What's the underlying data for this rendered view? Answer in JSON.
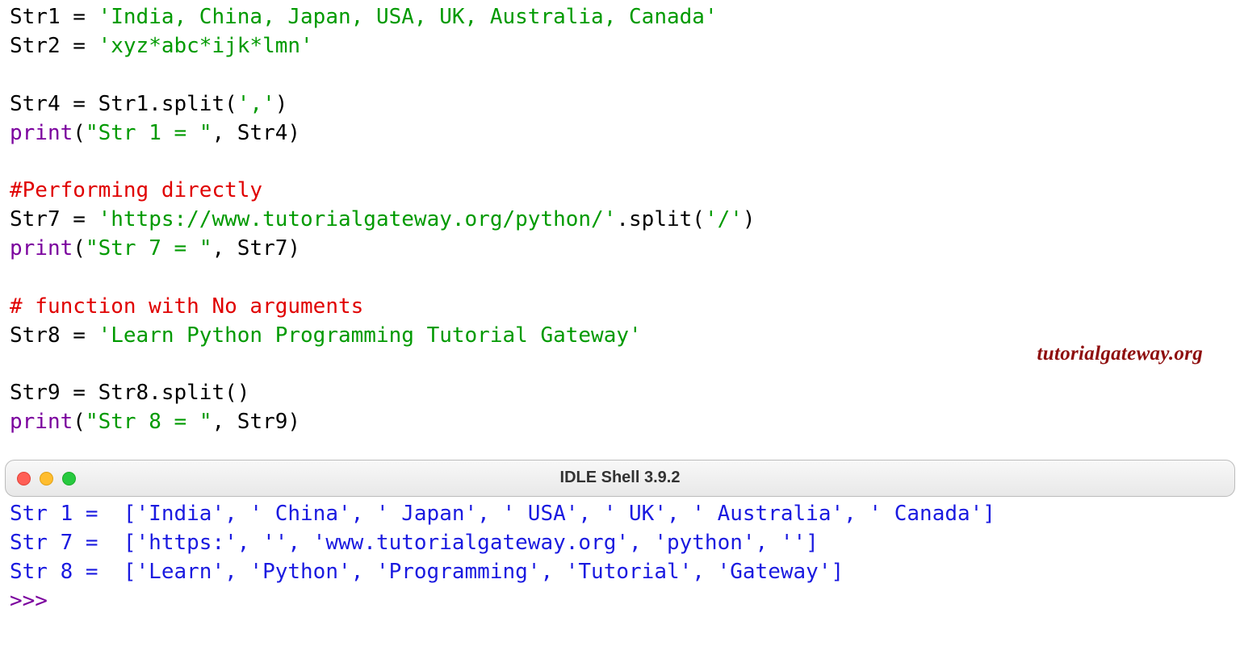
{
  "code": {
    "l1a": "Str1 = ",
    "l1b": "'India, China, Japan, USA, UK, Australia, Canada'",
    "l2a": "Str2 = ",
    "l2b": "'xyz*abc*ijk*lmn'",
    "l4a": "Str4 = Str1.split(",
    "l4b": "','",
    "l4c": ")",
    "l5a": "print",
    "l5b": "(",
    "l5c": "\"Str 1 = \"",
    "l5d": ", Str4)",
    "l7": "#Performing directly",
    "l8a": "Str7 = ",
    "l8b": "'https://www.tutorialgateway.org/python/'",
    "l8c": ".split(",
    "l8d": "'/'",
    "l8e": ")",
    "l9a": "print",
    "l9b": "(",
    "l9c": "\"Str 7 = \"",
    "l9d": ", Str7)",
    "l11": "# function with No arguments",
    "l12a": "Str8 = ",
    "l12b": "'Learn Python Programming Tutorial Gateway'",
    "l14": "Str9 = Str8.split()",
    "l15a": "print",
    "l15b": "(",
    "l15c": "\"Str 8 = \"",
    "l15d": ", Str9)"
  },
  "watermark": "tutorialgateway.org",
  "shell": {
    "title": "IDLE Shell 3.9.2",
    "out1": "Str 1 =  ['India', ' China', ' Japan', ' USA', ' UK', ' Australia', ' Canada']",
    "out2": "Str 7 =  ['https:', '', 'www.tutorialgateway.org', 'python', '']",
    "out3": "Str 8 =  ['Learn', 'Python', 'Programming', 'Tutorial', 'Gateway']",
    "prompt": ">>> "
  }
}
